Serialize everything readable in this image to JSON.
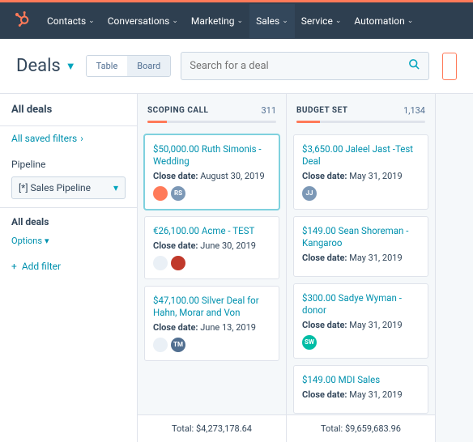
{
  "nav": {
    "items": [
      "Contacts",
      "Conversations",
      "Marketing",
      "Sales",
      "Service",
      "Automation"
    ],
    "active": 3
  },
  "header": {
    "title": "Deals",
    "toggle": {
      "table": "Table",
      "board": "Board"
    },
    "search_placeholder": "Search for a deal"
  },
  "sidebar": {
    "all_deals": "All deals",
    "all_saved": "All saved filters",
    "pipeline_label": "Pipeline",
    "pipeline_value": "[*] Sales Pipeline",
    "section": "All deals",
    "options": "Options",
    "add_filter": "Add filter"
  },
  "columns": [
    {
      "title": "SCOPING CALL",
      "count": "311",
      "progress": 15,
      "total": "Total: $4,273,178.64",
      "cards": [
        {
          "title": "$50,000.00 Ruth Simonis - Wedding",
          "date_label": "Close date:",
          "date": "August 30, 2019",
          "avatars": [
            {
              "bg": "#ff7a59",
              "txt": ""
            },
            {
              "bg": "#7c98b6",
              "txt": "RS"
            }
          ],
          "active": true
        },
        {
          "title": "€26,100.00 Acme - TEST",
          "date_label": "Close date:",
          "date": "June 30, 2019",
          "avatars": [
            {
              "bg": "#eaf0f6",
              "txt": ""
            },
            {
              "bg": "#c0392b",
              "txt": ""
            }
          ]
        },
        {
          "title": "$47,100.00 Silver Deal for Hahn, Morar and Von",
          "date_label": "Close date:",
          "date": "June 13, 2019",
          "avatars": [
            {
              "bg": "#eaf0f6",
              "txt": ""
            },
            {
              "bg": "#516f90",
              "txt": "TM"
            }
          ]
        }
      ]
    },
    {
      "title": "BUDGET SET",
      "count": "1,134",
      "progress": 18,
      "total": "Total: $9,659,683.96",
      "cards": [
        {
          "title": "$3,650.00 Jaleel Jast -Test Deal",
          "date_label": "Close date:",
          "date": "May 31, 2019",
          "avatars": [
            {
              "bg": "#7c98b6",
              "txt": "JJ"
            }
          ]
        },
        {
          "title": "$149.00 Sean Shoreman - Kangaroo",
          "date_label": "Close date:",
          "date": "May 31, 2019",
          "avatars": []
        },
        {
          "title": "$300.00 Sadye Wyman - donor",
          "date_label": "Close date:",
          "date": "May 31, 2019",
          "avatars": [
            {
              "bg": "#00bda5",
              "txt": "SW"
            }
          ]
        },
        {
          "title": "$149.00 MDI Sales",
          "date_label": "Close date:",
          "date": "May 31, 2019",
          "avatars": []
        }
      ]
    }
  ]
}
